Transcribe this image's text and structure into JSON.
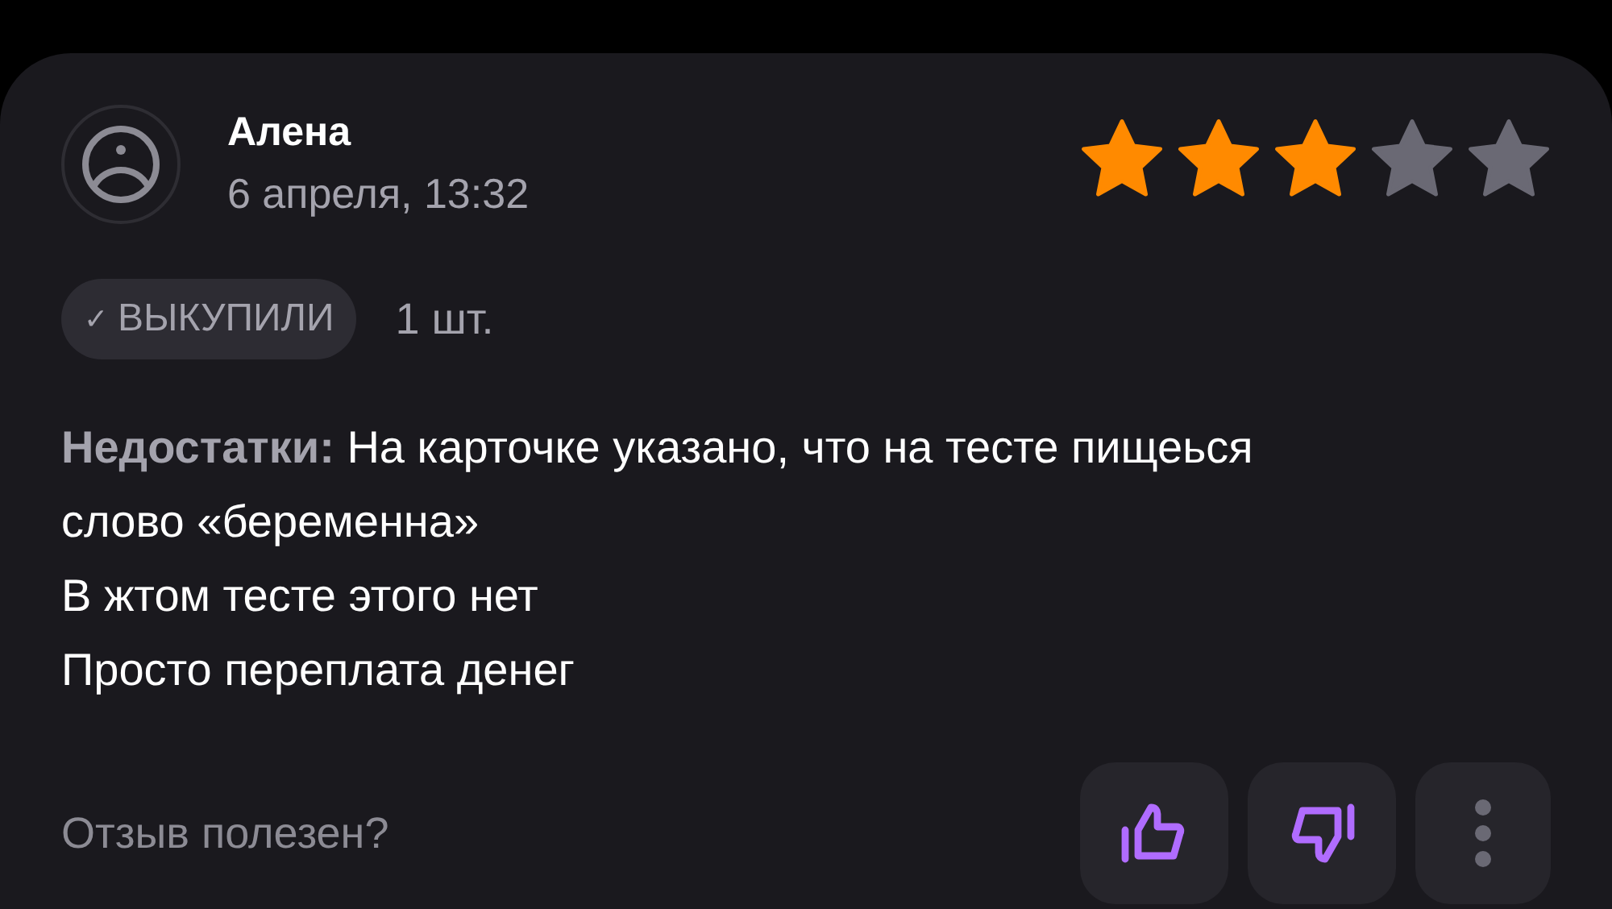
{
  "review": {
    "author": "Алена",
    "date": "6 апреля, 13:32",
    "stars": 3,
    "badge": {
      "check": "✓",
      "label": "ВЫКУПИЛИ"
    },
    "quantity": "1 шт.",
    "body": {
      "label": "Недостатки:",
      "text": "На карточке указано, что на тесте пищеься слово «беременна»\nВ жтом тесте этого нет\nПросто переплата денег"
    },
    "helpful_prompt": "Отзыв полезен?"
  }
}
